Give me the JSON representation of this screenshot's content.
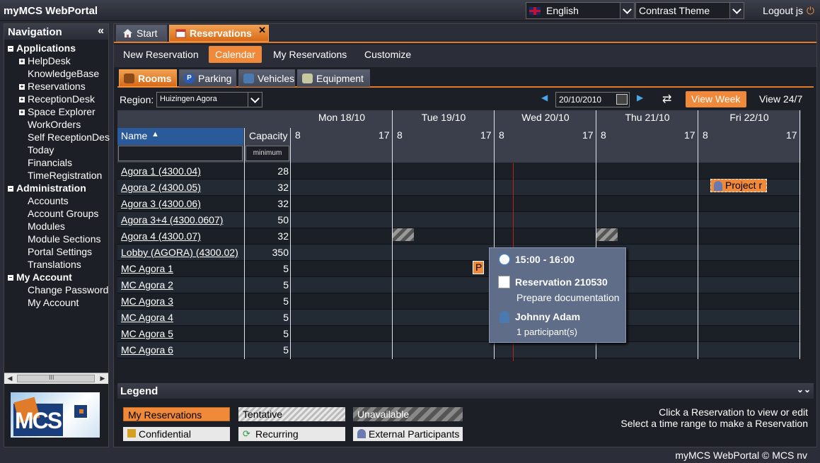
{
  "app_title": "myMCS WebPortal",
  "header": {
    "language": "English",
    "theme": "Contrast Theme",
    "logout": "Logout js"
  },
  "nav": {
    "title": "Navigation",
    "items": [
      {
        "label": "Applications",
        "level": 0,
        "expand": "minus"
      },
      {
        "label": "HelpDesk",
        "level": 1,
        "expand": "plus"
      },
      {
        "label": "KnowledgeBase",
        "level": 1
      },
      {
        "label": "Reservations",
        "level": 1,
        "expand": "plus"
      },
      {
        "label": "ReceptionDesk",
        "level": 1,
        "expand": "plus"
      },
      {
        "label": "Space Explorer",
        "level": 1,
        "expand": "plus"
      },
      {
        "label": "WorkOrders",
        "level": 1
      },
      {
        "label": "Self ReceptionDes",
        "level": 1
      },
      {
        "label": "Today",
        "level": 1
      },
      {
        "label": "Financials",
        "level": 1
      },
      {
        "label": "TimeRegistration",
        "level": 1
      },
      {
        "label": "Administration",
        "level": 0,
        "expand": "minus"
      },
      {
        "label": "Accounts",
        "level": 1
      },
      {
        "label": "Account Groups",
        "level": 1
      },
      {
        "label": "Modules",
        "level": 1
      },
      {
        "label": "Module Sections",
        "level": 1
      },
      {
        "label": "Portal Settings",
        "level": 1
      },
      {
        "label": "Translations",
        "level": 1
      },
      {
        "label": "My Account",
        "level": 0,
        "expand": "minus"
      },
      {
        "label": "Change Password",
        "level": 1
      },
      {
        "label": "My Account",
        "level": 1
      }
    ],
    "scroll_label": "III",
    "logo_text": "MCS"
  },
  "tabs": {
    "start": "Start",
    "reservations": "Reservations",
    "close": "✕"
  },
  "submenu": {
    "new_reservation": "New Reservation",
    "calendar": "Calendar",
    "my_reservations": "My Reservations",
    "customize": "Customize"
  },
  "resource_tabs": {
    "rooms": "Rooms",
    "parking": "Parking",
    "vehicles": "Vehicles",
    "equipment": "Equipment"
  },
  "toolbar": {
    "region_label": "Region:",
    "region_value": "Huizingen Agora",
    "date_value": "20/10/2010",
    "view_week": "View Week",
    "view_247": "View 24/7"
  },
  "grid": {
    "name_header": "Name",
    "capacity_header": "Capacity",
    "capacity_filter": "minimum",
    "days": [
      "Mon 18/10",
      "Tue 19/10",
      "Wed 20/10",
      "Thu 21/10",
      "Fri 22/10"
    ],
    "hour_start": "8",
    "hour_end": "17",
    "rooms": [
      {
        "name": "Agora 1 (4300.04)",
        "capacity": "28"
      },
      {
        "name": "Agora 2 (4300.05)",
        "capacity": "32"
      },
      {
        "name": "Agora 3 (4300.06)",
        "capacity": "32"
      },
      {
        "name": "Agora 3+4 (4300.0607)",
        "capacity": "50"
      },
      {
        "name": "Agora 4 (4300.07)",
        "capacity": "32"
      },
      {
        "name": "Lobby (AGORA) (4300.02)",
        "capacity": "350"
      },
      {
        "name": "MC Agora 1",
        "capacity": "5"
      },
      {
        "name": "MC Agora 2",
        "capacity": "5"
      },
      {
        "name": "MC Agora 3",
        "capacity": "5"
      },
      {
        "name": "MC Agora 4",
        "capacity": "5"
      },
      {
        "name": "MC Agora 5",
        "capacity": "5"
      },
      {
        "name": "MC Agora 6",
        "capacity": "5"
      }
    ],
    "event_project": "Project r",
    "event_p": "P"
  },
  "tooltip": {
    "time": "15:00 - 16:00",
    "reservation": "Reservation 210530",
    "description": "Prepare documentation",
    "person": "Johnny Adam",
    "participants": "1 participant(s)"
  },
  "legend": {
    "title": "Legend",
    "my_reservations": "My Reservations",
    "tentative": "Tentative",
    "unavailable": "Unavailable",
    "confidential": "Confidential",
    "recurring": "Recurring",
    "external": "External Participants",
    "hint1": "Click a Reservation to view or edit",
    "hint2": "Select a time range to make a Reservation"
  },
  "footer": "myMCS WebPortal © MCS nv",
  "colors": {
    "accent": "#f08a3a",
    "bg": "#2b2e38",
    "panel": "#1d1f26"
  }
}
